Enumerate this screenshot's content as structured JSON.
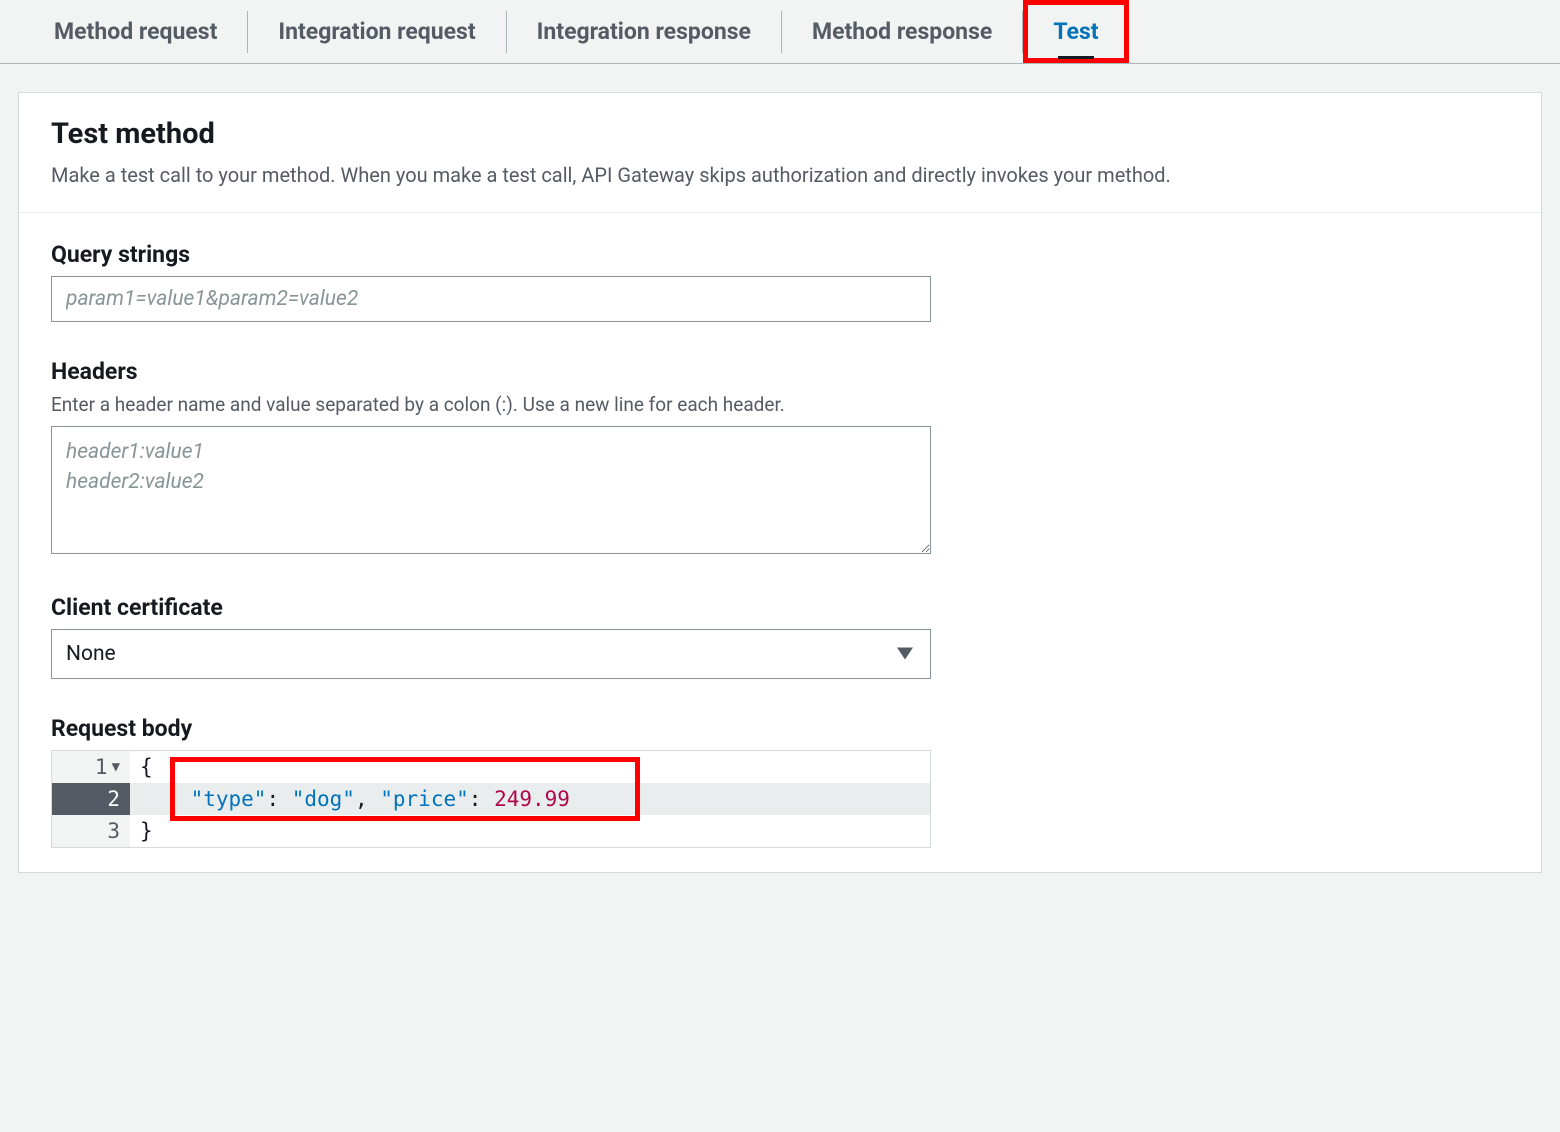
{
  "tabs": {
    "items": [
      {
        "label": "Method request"
      },
      {
        "label": "Integration request"
      },
      {
        "label": "Integration response"
      },
      {
        "label": "Method response"
      },
      {
        "label": "Test"
      }
    ],
    "active_index": 4
  },
  "header": {
    "title": "Test method",
    "description": "Make a test call to your method. When you make a test call, API Gateway skips authorization and directly invokes your method."
  },
  "query_strings": {
    "label": "Query strings",
    "placeholder": "param1=value1&param2=value2",
    "value": ""
  },
  "headers": {
    "label": "Headers",
    "hint": "Enter a header name and value separated by a colon (:). Use a new line for each header.",
    "placeholder": "header1:value1\nheader2:value2",
    "value": ""
  },
  "client_certificate": {
    "label": "Client certificate",
    "selected": "None",
    "options": [
      "None"
    ]
  },
  "request_body": {
    "label": "Request body",
    "lines": [
      {
        "n": "1",
        "foldable": true,
        "tokens": [
          {
            "t": "punct",
            "v": "{"
          }
        ]
      },
      {
        "n": "2",
        "active": true,
        "tokens": [
          {
            "t": "indent",
            "v": "    "
          },
          {
            "t": "key",
            "v": "\"type\""
          },
          {
            "t": "punct",
            "v": ": "
          },
          {
            "t": "str",
            "v": "\"dog\""
          },
          {
            "t": "punct",
            "v": ", "
          },
          {
            "t": "key",
            "v": "\"price\""
          },
          {
            "t": "punct",
            "v": ": "
          },
          {
            "t": "num",
            "v": "249.99"
          }
        ]
      },
      {
        "n": "3",
        "tokens": [
          {
            "t": "punct",
            "v": "}"
          }
        ]
      }
    ]
  }
}
